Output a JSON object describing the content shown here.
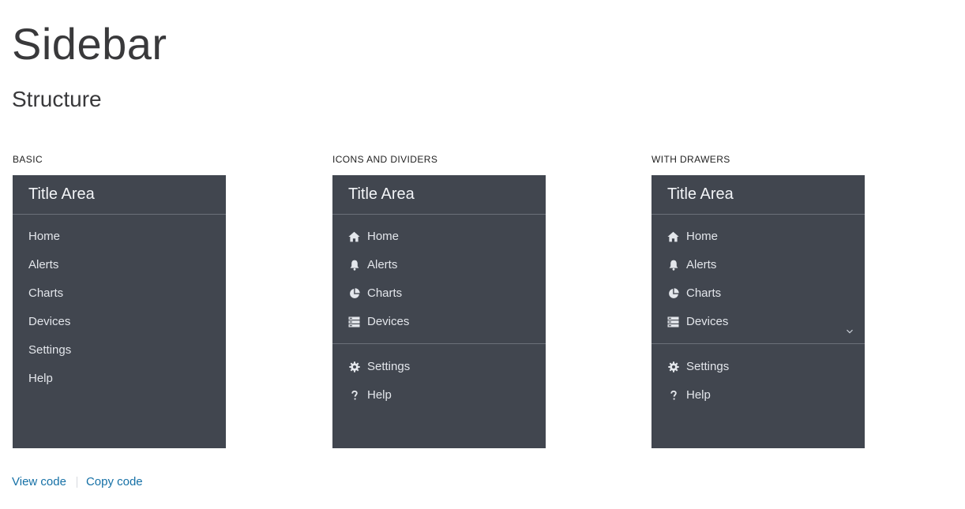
{
  "page": {
    "title": "Sidebar",
    "section_title": "Structure"
  },
  "examples": [
    {
      "label": "BASIC",
      "title": "Title Area",
      "items": [
        "Home",
        "Alerts",
        "Charts",
        "Devices",
        "Settings",
        "Help"
      ]
    },
    {
      "label": "ICONS AND DIVIDERS",
      "title": "Title Area",
      "items": [
        "Home",
        "Alerts",
        "Charts",
        "Devices",
        "Settings",
        "Help"
      ]
    },
    {
      "label": "WITH DRAWERS",
      "title": "Title Area",
      "items": [
        "Home",
        "Alerts",
        "Charts",
        "Devices",
        "Settings",
        "Help"
      ]
    }
  ],
  "footer": {
    "view_code": "View code",
    "copy_code": "Copy code"
  },
  "icons": {
    "home": "home-icon",
    "alerts": "bell-icon",
    "charts": "pie-chart-icon",
    "devices": "server-icon",
    "settings": "gear-icon",
    "help": "question-icon",
    "drawer": "chevron-down-icon"
  },
  "colors": {
    "sidebar_bg": "#41464f",
    "sidebar_divider": "#6b7079",
    "sidebar_text": "#e3e6eb",
    "link": "#1570a6"
  }
}
